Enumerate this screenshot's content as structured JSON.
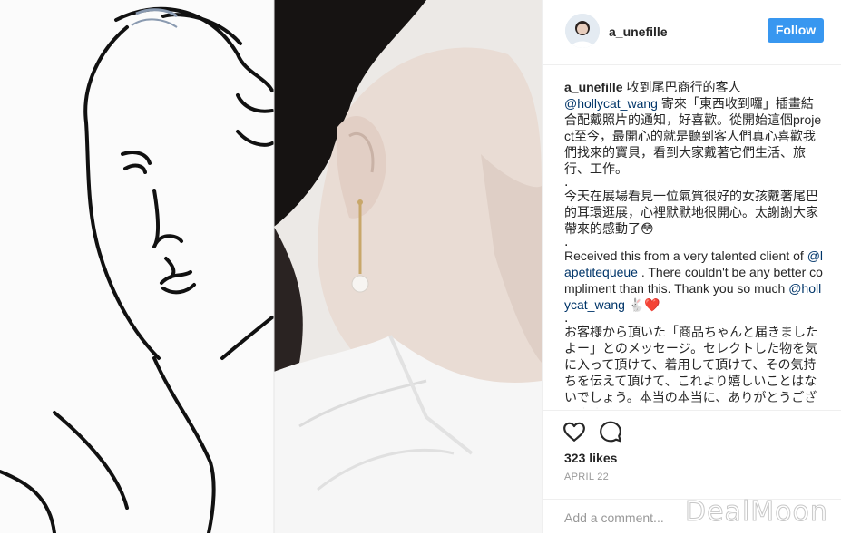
{
  "post": {
    "username": "a_unefille",
    "follow_label": "Follow",
    "caption": {
      "username": "a_unefille",
      "p1_lead": " 收到尾巴商行的客人",
      "p1_mention": "@hollycat_wang",
      "p1_rest": " 寄來「東西收到囉」插畫結合配戴照片的通知，好喜歡。從開始這個project至今，最開心的就是聽到客人們真心喜歡我們找來的寶貝，看到大家戴著它們生活、旅行、工作。",
      "dot": ".",
      "p2": "今天在展場看見一位氣質很好的女孩戴著尾巴的耳環逛展，心裡默默地很開心。太謝謝大家帶來的感動了😳",
      "p3_lead": "Received this from a very talented client of ",
      "p3_mention1": "@lapetitequeue",
      "p3_mid": " . There couldn't be any better compliment than this. Thank you so much ",
      "p3_mention2": "@hollycat_wang",
      "p3_end": " 🐇❤️",
      "p4": "お客様から頂いた「商品ちゃんと届きましたよー」とのメッセージ。セレクトした物を気に入って頂けて、着用して頂けて、その気持ちを伝えて頂けて、これより嬉しいことはないでしょう。本当の本当に、ありがとうございます。"
    },
    "likes": "323 likes",
    "date": "APRIL 22",
    "comment_placeholder": "Add a comment...",
    "icons": {
      "like": "heart-icon",
      "comment": "comment-icon",
      "more": "more-options-icon"
    },
    "colors": {
      "follow_button": "#3897f0",
      "mention": "#003569",
      "muted": "#999999"
    }
  },
  "watermark": "DealMoon"
}
